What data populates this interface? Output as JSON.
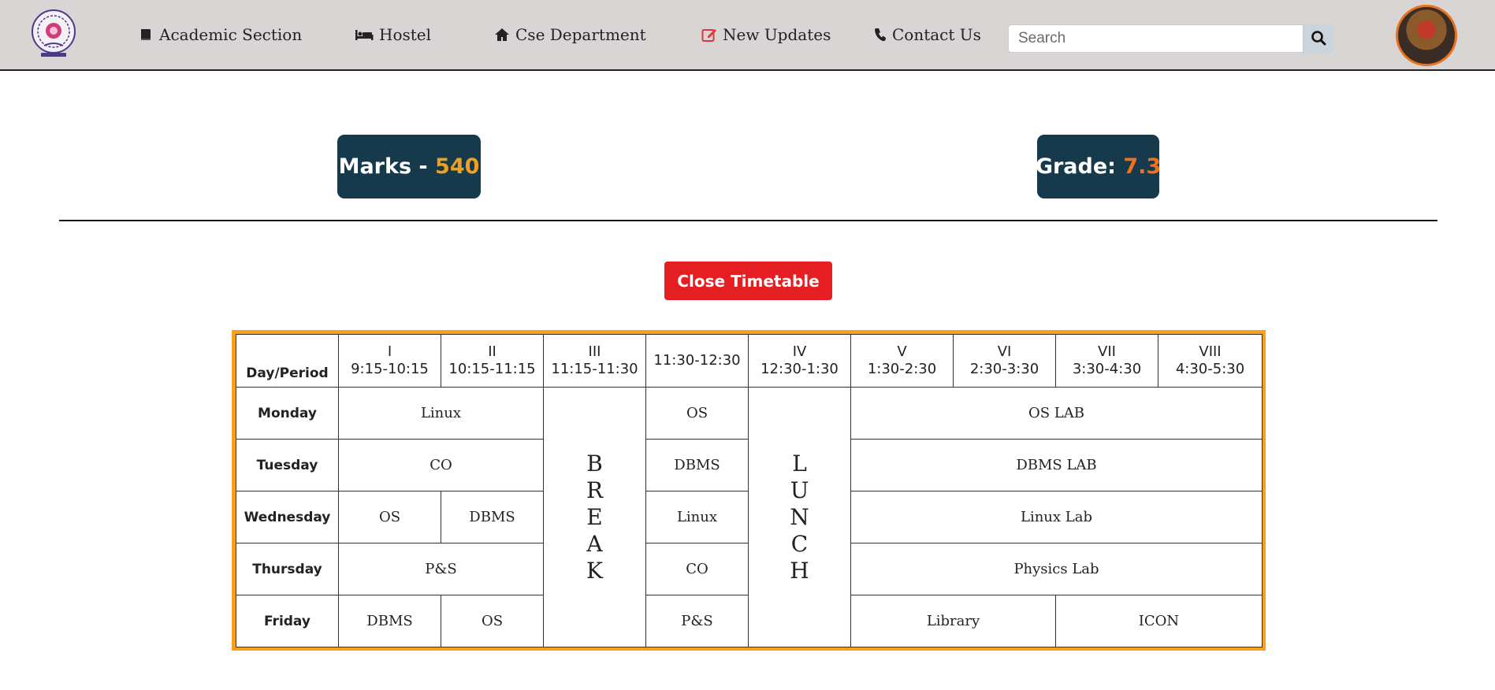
{
  "nav": {
    "links": [
      {
        "label": "Academic Section",
        "icon": "book-icon"
      },
      {
        "label": "Hostel",
        "icon": "bed-icon"
      },
      {
        "label": "Cse Department",
        "icon": "home-icon"
      },
      {
        "label": "New Updates",
        "icon": "edit-icon"
      },
      {
        "label": "Contact Us",
        "icon": "phone-icon"
      }
    ],
    "search_placeholder": "Search",
    "search_value": ""
  },
  "stats": {
    "marks_label": "Marks - ",
    "marks_value": "540",
    "grade_label": "Grade: ",
    "grade_value": "7.3"
  },
  "close_button": "Close Timetable",
  "timetable": {
    "header": {
      "day_period": "Day/Period",
      "periods": [
        {
          "num": "I",
          "time": "9:15-10:15"
        },
        {
          "num": "II",
          "time": "10:15-11:15"
        },
        {
          "num": "III",
          "time": "11:15-11:30"
        },
        {
          "num": "",
          "time": "11:30-12:30"
        },
        {
          "num": "IV",
          "time": "12:30-1:30"
        },
        {
          "num": "V",
          "time": "1:30-2:30"
        },
        {
          "num": "VI",
          "time": "2:30-3:30"
        },
        {
          "num": "VII",
          "time": "3:30-4:30"
        },
        {
          "num": "VIII",
          "time": "4:30-5:30"
        }
      ]
    },
    "break_letters": [
      "B",
      "R",
      "E",
      "A",
      "K"
    ],
    "lunch_letters": [
      "L",
      "U",
      "N",
      "C",
      "H"
    ],
    "rows": {
      "monday": {
        "day": "Monday",
        "p12": "Linux",
        "p4": "OS",
        "lab": "OS LAB"
      },
      "tuesday": {
        "day": "Tuesday",
        "p12": "CO",
        "p4": "DBMS",
        "lab": "DBMS LAB"
      },
      "wednesday": {
        "day": "Wednesday",
        "p1": "OS",
        "p2": "DBMS",
        "p4": "Linux",
        "lab": "Linux Lab"
      },
      "thursday": {
        "day": "Thursday",
        "p12": "P&S",
        "p4": "CO",
        "lab": "Physics Lab"
      },
      "friday": {
        "day": "Friday",
        "p1": "DBMS",
        "p2": "OS",
        "p4": "P&S",
        "lab1": "Library",
        "lab2": "ICON"
      }
    }
  },
  "colors": {
    "navbar_bg": "#d8d5d4",
    "stat_bg": "#163a4c",
    "marks_accent": "#f0a020",
    "grade_accent": "#f26f1c",
    "close_button_bg": "#e41e22",
    "table_frame": "#f4a21d"
  }
}
